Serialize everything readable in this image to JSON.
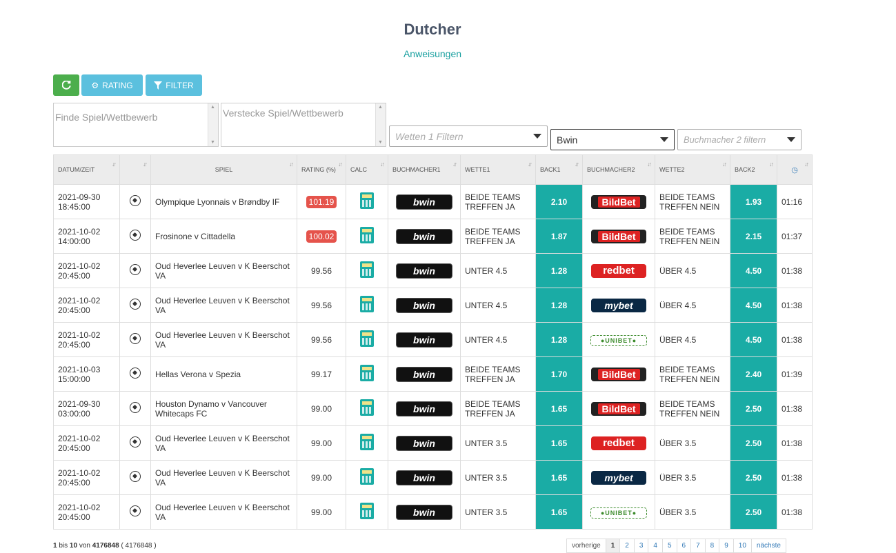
{
  "header": {
    "title": "Dutcher",
    "instructions": "Anweisungen"
  },
  "toolbar": {
    "rating_label": "RATING",
    "filter_label": "FILTER"
  },
  "filters": {
    "find_placeholder": "Finde Spiel/Wettbewerb",
    "hide_placeholder": "Verstecke Spiel/Wettbewerb",
    "bet1_placeholder": "Wetten 1 Filtern",
    "bookmaker1_value": "Bwin",
    "bookmaker2_placeholder": "Buchmacher 2 filtern"
  },
  "table": {
    "headers": {
      "datetime": "DATUM/ZEIT",
      "game": "SPIEL",
      "rating": "RATING (%)",
      "calc": "CALC",
      "bm1": "BUCHMACHER1",
      "bet1": "WETTE1",
      "back1": "BACK1",
      "bm2": "BUCHMACHER2",
      "bet2": "WETTE2",
      "back2": "BACK2"
    },
    "rows": [
      {
        "date": "2021-09-30",
        "time": "18:45:00",
        "game": "Olympique Lyonnais v Brøndby IF",
        "rating": "101.19",
        "hl": true,
        "bm1": "bwin",
        "bet1": "BEIDE TEAMS TREFFEN JA",
        "back1": "2.10",
        "bm2": "BildBet",
        "bet2": "BEIDE TEAMS TREFFEN NEIN",
        "back2": "1.93",
        "clock": "01:16"
      },
      {
        "date": "2021-10-02",
        "time": "14:00:00",
        "game": "Frosinone v Cittadella",
        "rating": "100.02",
        "hl": true,
        "bm1": "bwin",
        "bet1": "BEIDE TEAMS TREFFEN JA",
        "back1": "1.87",
        "bm2": "BildBet",
        "bet2": "BEIDE TEAMS TREFFEN NEIN",
        "back2": "2.15",
        "clock": "01:37"
      },
      {
        "date": "2021-10-02",
        "time": "20:45:00",
        "game": "Oud Heverlee Leuven v K Beerschot VA",
        "rating": "99.56",
        "hl": false,
        "bm1": "bwin",
        "bet1": "UNTER 4.5",
        "back1": "1.28",
        "bm2": "redbet",
        "bet2": "ÜBER 4.5",
        "back2": "4.50",
        "clock": "01:38"
      },
      {
        "date": "2021-10-02",
        "time": "20:45:00",
        "game": "Oud Heverlee Leuven v K Beerschot VA",
        "rating": "99.56",
        "hl": false,
        "bm1": "bwin",
        "bet1": "UNTER 4.5",
        "back1": "1.28",
        "bm2": "mybet",
        "bet2": "ÜBER 4.5",
        "back2": "4.50",
        "clock": "01:38"
      },
      {
        "date": "2021-10-02",
        "time": "20:45:00",
        "game": "Oud Heverlee Leuven v K Beerschot VA",
        "rating": "99.56",
        "hl": false,
        "bm1": "bwin",
        "bet1": "UNTER 4.5",
        "back1": "1.28",
        "bm2": "unibet",
        "bet2": "ÜBER 4.5",
        "back2": "4.50",
        "clock": "01:38"
      },
      {
        "date": "2021-10-03",
        "time": "15:00:00",
        "game": "Hellas Verona v Spezia",
        "rating": "99.17",
        "hl": false,
        "bm1": "bwin",
        "bet1": "BEIDE TEAMS TREFFEN JA",
        "back1": "1.70",
        "bm2": "BildBet",
        "bet2": "BEIDE TEAMS TREFFEN NEIN",
        "back2": "2.40",
        "clock": "01:39"
      },
      {
        "date": "2021-09-30",
        "time": "03:00:00",
        "game": "Houston Dynamo v Vancouver Whitecaps FC",
        "rating": "99.00",
        "hl": false,
        "bm1": "bwin",
        "bet1": "BEIDE TEAMS TREFFEN JA",
        "back1": "1.65",
        "bm2": "BildBet",
        "bet2": "BEIDE TEAMS TREFFEN NEIN",
        "back2": "2.50",
        "clock": "01:38"
      },
      {
        "date": "2021-10-02",
        "time": "20:45:00",
        "game": "Oud Heverlee Leuven v K Beerschot VA",
        "rating": "99.00",
        "hl": false,
        "bm1": "bwin",
        "bet1": "UNTER 3.5",
        "back1": "1.65",
        "bm2": "redbet",
        "bet2": "ÜBER 3.5",
        "back2": "2.50",
        "clock": "01:38"
      },
      {
        "date": "2021-10-02",
        "time": "20:45:00",
        "game": "Oud Heverlee Leuven v K Beerschot VA",
        "rating": "99.00",
        "hl": false,
        "bm1": "bwin",
        "bet1": "UNTER 3.5",
        "back1": "1.65",
        "bm2": "mybet",
        "bet2": "ÜBER 3.5",
        "back2": "2.50",
        "clock": "01:38"
      },
      {
        "date": "2021-10-02",
        "time": "20:45:00",
        "game": "Oud Heverlee Leuven v K Beerschot VA",
        "rating": "99.00",
        "hl": false,
        "bm1": "bwin",
        "bet1": "UNTER 3.5",
        "back1": "1.65",
        "bm2": "unibet",
        "bet2": "ÜBER 3.5",
        "back2": "2.50",
        "clock": "01:38"
      }
    ]
  },
  "footer": {
    "from": "1",
    "bis": "bis",
    "to": "10",
    "von": "von",
    "total": "4176848",
    "total_paren": "( 4176848 )"
  },
  "pagination": {
    "prev": "vorherige",
    "pages": [
      "1",
      "2",
      "3",
      "4",
      "5",
      "6",
      "7",
      "8",
      "9",
      "10"
    ],
    "next": "nächste"
  }
}
